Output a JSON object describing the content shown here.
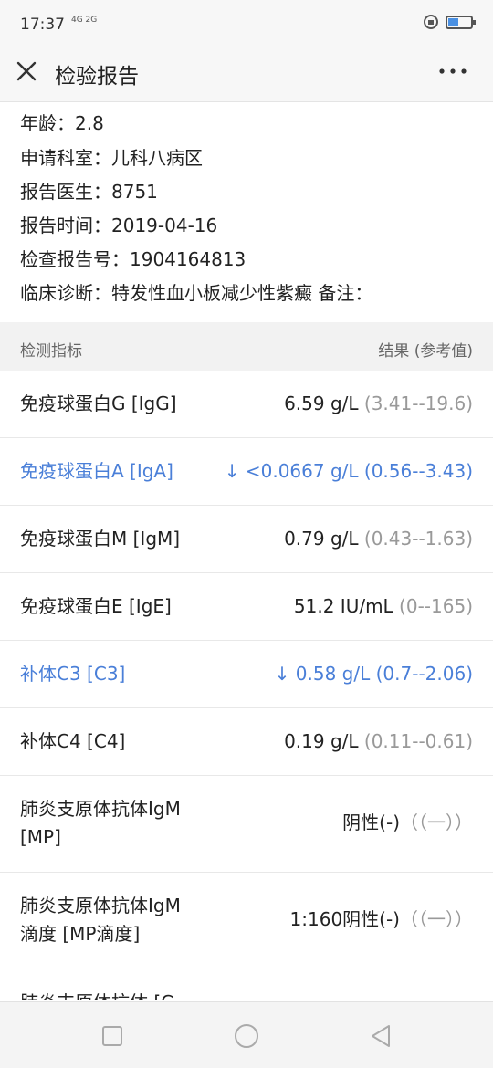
{
  "status_bar": {
    "time": "17:37",
    "network": "4G 2G",
    "icons": [
      "lock-icon",
      "battery-icon"
    ],
    "battery_color": "#4a90e2"
  },
  "app_bar": {
    "title": "检验报告",
    "left_icon": "close-icon",
    "right_icon": "more-icon"
  },
  "info": [
    "年龄：2.8",
    "申请科室：儿科八病区",
    "报告医生：8751",
    "报告时间：2019-04-16",
    "检查报告号：1904164813",
    "临床诊断：特发性血小板减少性紫癜 备注："
  ],
  "table": {
    "header_left": "检测指标",
    "header_right": "结果 (参考值)",
    "accent_abnormal": "#4a7fd8",
    "rows": [
      {
        "name": "免疫球蛋白G [IgG]",
        "value": "6.59 g/L",
        "ref": " (3.41--19.6)",
        "abnormal": false
      },
      {
        "name": "免疫球蛋白A [IgA]",
        "value": "↓ <0.0667 g/L",
        "ref": "  (0.56--3.43)",
        "abnormal": true
      },
      {
        "name": "免疫球蛋白M [IgM]",
        "value": "0.79 g/L",
        "ref": " (0.43--1.63)",
        "abnormal": false
      },
      {
        "name": "免疫球蛋白E [IgE]",
        "value": "51.2 IU/mL",
        "ref": " (0--165)",
        "abnormal": false
      },
      {
        "name": "补体C3 [C3]",
        "value": "↓ 0.58 g/L",
        "ref": "  (0.7--2.06)",
        "abnormal": true
      },
      {
        "name": "补体C4 [C4]",
        "value": "0.19 g/L",
        "ref": " (0.11--0.61)",
        "abnormal": false
      },
      {
        "name": "肺炎支原体抗体IgM [MP]",
        "value": "阴性(-)",
        "ref": "（（一））",
        "abnormal": false
      },
      {
        "name": "肺炎支原体抗体IgM 滴度 [MP滴度]",
        "value": "1:160阴性(-)",
        "ref": "（（一））",
        "abnormal": false
      },
      {
        "name": "肺炎支原体抗体 [C",
        "value": "",
        "ref": "",
        "abnormal": false
      }
    ]
  },
  "nav_bar": {
    "buttons": [
      "recent-apps-icon",
      "home-icon",
      "back-icon"
    ]
  }
}
